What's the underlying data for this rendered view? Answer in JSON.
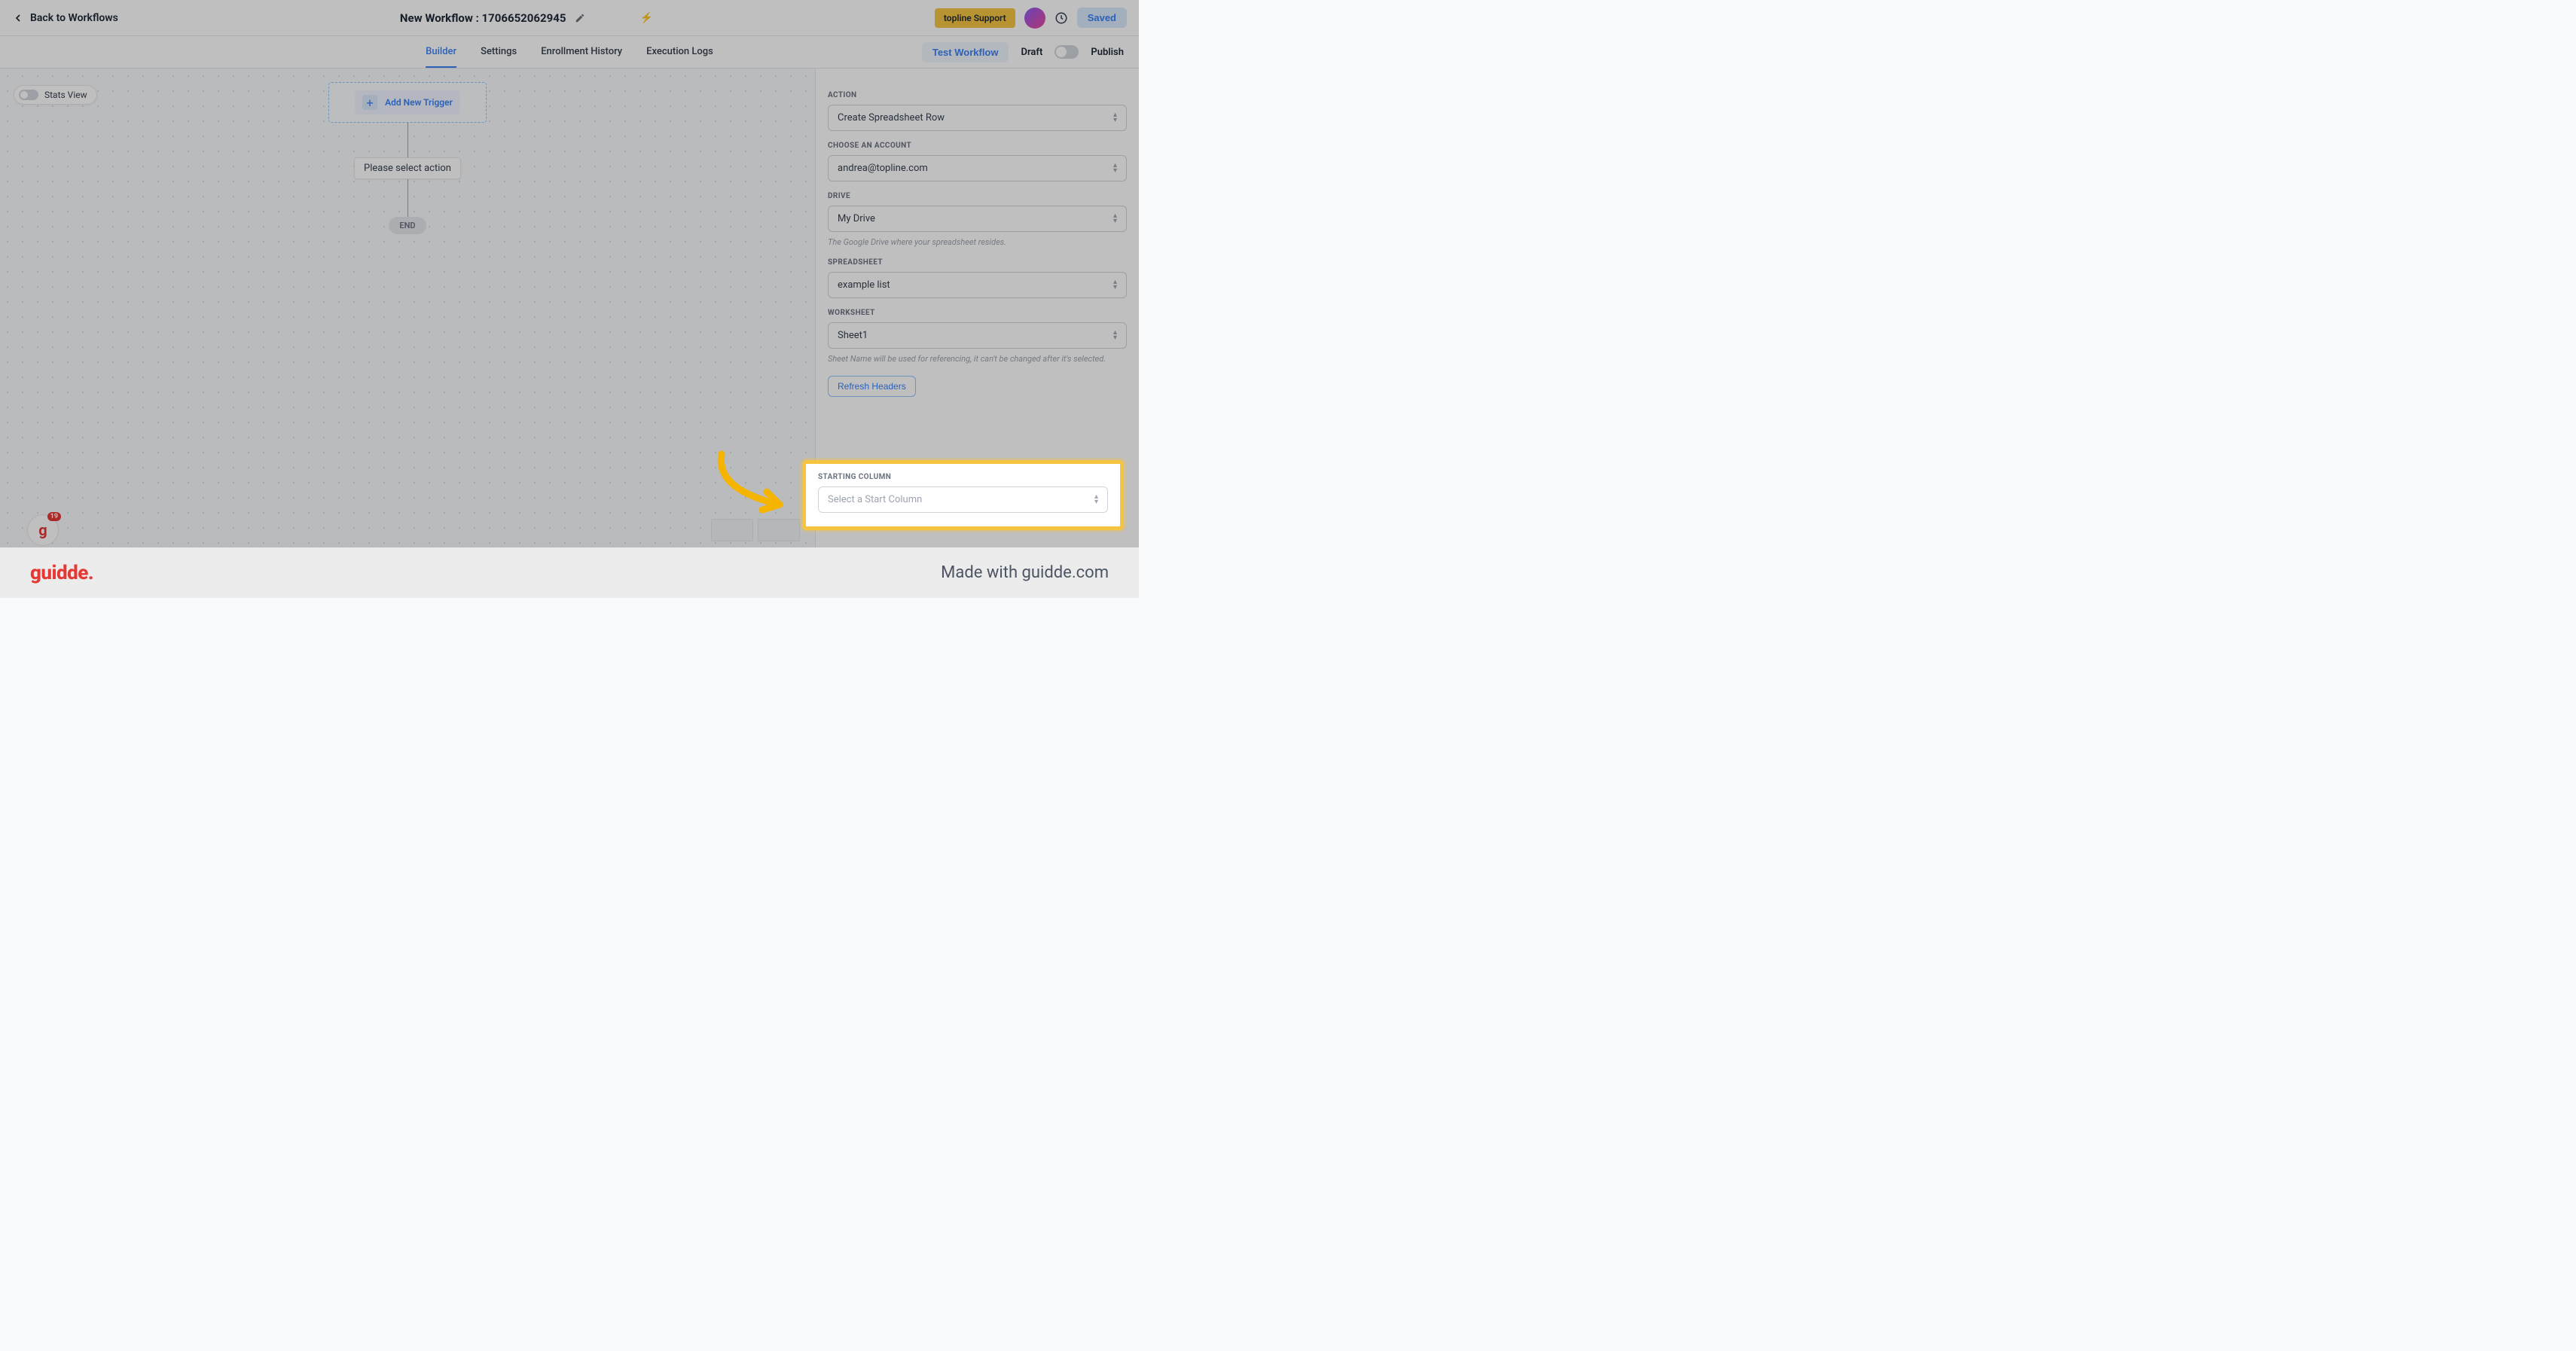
{
  "header": {
    "back_label": "Back to Workflows",
    "workflow_title": "New Workflow : 1706652062945",
    "support_label": "topline Support",
    "saved_label": "Saved"
  },
  "tabs": {
    "items": [
      {
        "label": "Builder",
        "active": true
      },
      {
        "label": "Settings",
        "active": false
      },
      {
        "label": "Enrollment History",
        "active": false
      },
      {
        "label": "Execution Logs",
        "active": false
      }
    ],
    "test_label": "Test Workflow",
    "draft_label": "Draft",
    "publish_label": "Publish"
  },
  "canvas": {
    "stats_view_label": "Stats View",
    "add_trigger_label": "Add New Trigger",
    "action_placeholder": "Please select action",
    "end_label": "END",
    "badge_count": "19"
  },
  "sidepanel": {
    "action": {
      "label": "ACTION",
      "value": "Create Spreadsheet Row"
    },
    "account": {
      "label": "CHOOSE AN ACCOUNT",
      "value": "andrea@topline.com"
    },
    "drive": {
      "label": "DRIVE",
      "value": "My Drive",
      "helper": "The Google Drive where your spreadsheet resides."
    },
    "spreadsheet": {
      "label": "SPREADSHEET",
      "value": "example list"
    },
    "worksheet": {
      "label": "WORKSHEET",
      "value": "Sheet1",
      "helper": "Sheet Name will be used for referencing, it can't be changed after it's selected."
    },
    "refresh_label": "Refresh Headers",
    "starting_column": {
      "label": "STARTING COLUMN",
      "placeholder": "Select a Start Column"
    }
  },
  "footer": {
    "logo": "guidde.",
    "made_with": "Made with guidde.com"
  }
}
